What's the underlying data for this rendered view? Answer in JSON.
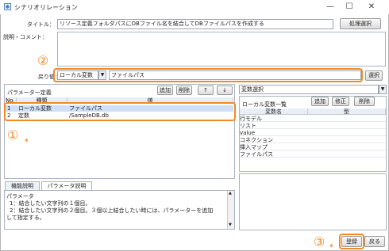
{
  "window": {
    "title": "シナリオリレーション",
    "min": "—",
    "max": "☐",
    "close": "✕"
  },
  "form": {
    "title_label": "タイトル：",
    "title_value": "リソース定義フォルダパスにDBファイル名を結合してDBファイルパスを作成する",
    "template_button": "処理選択",
    "desc_label": "説明・コメント：",
    "return_label": "戻り値：",
    "return_type": "ローカル変数",
    "return_value": "ファイルパス",
    "return_select_button": "選択"
  },
  "params": {
    "header": "パラメーター定義",
    "buttons": [
      "追加",
      "削除",
      "↑",
      "↓"
    ],
    "columns": [
      "No.",
      "種類",
      "値"
    ],
    "rows": [
      {
        "no": "1",
        "type": "ローカル変数",
        "value": "ファイルパス"
      },
      {
        "no": "2",
        "type": "定数",
        "value": "/SampleDB.db"
      }
    ]
  },
  "var_panel": {
    "dropdown": "変数選択",
    "header": "ローカル変数一覧",
    "buttons": [
      "追加",
      "修正",
      "削除"
    ],
    "columns": [
      "変数名",
      "型"
    ],
    "rows": [
      "行モデル",
      "リスト",
      "value",
      "コネクション",
      "挿入マップ",
      "ファイルパス"
    ]
  },
  "tabs": [
    "機能説明",
    "パラメータ説明"
  ],
  "help": {
    "heading": "パラメータ",
    "lines": [
      "1：結合したい文字列の１個目。",
      "2：結合したい文字列の２個目。３個以上結合したい時には、パラメーターを追加",
      "して指定する。"
    ]
  },
  "footer": {
    "register": "登録",
    "back": "戻る"
  },
  "callouts": {
    "c1": "①",
    "c2": "②",
    "c3": "③"
  },
  "colors": {
    "highlight": "#f08a24",
    "selected_row": "#cfe0f6"
  }
}
